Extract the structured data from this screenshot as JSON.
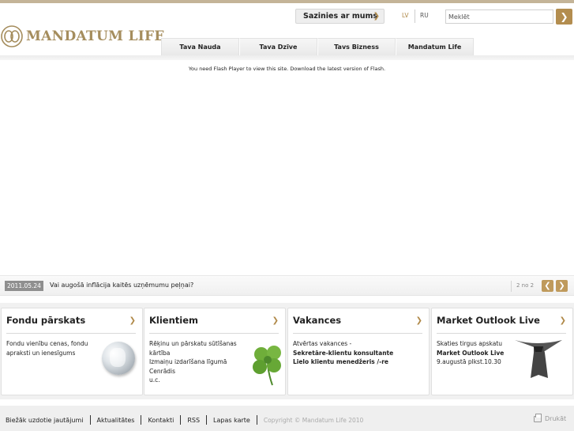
{
  "header": {
    "logo_text": "MANDATUM LIFE",
    "contact_label": "Sazinies ar mums",
    "languages": [
      "LV",
      "RU"
    ],
    "search_placeholder": "Meklēt"
  },
  "nav": {
    "tabs": [
      "Tava Nauda",
      "Tava Dzīve",
      "Tavs Bizness",
      "Mandatum Life"
    ]
  },
  "main": {
    "flash_message": "You need Flash Player to view this site. Download the latest version of Flash."
  },
  "news": {
    "date": "2011.05.24",
    "headline": "Vai augošā inflācija kaitēs uzņēmumu peļņai?",
    "pager": "2 no 2"
  },
  "boxes": [
    {
      "title": "Fondu pārskats",
      "lines": [
        "Fondu vienību cenas, fondu",
        "apraksti un ienesīgums"
      ]
    },
    {
      "title": "Klientiem",
      "lines": [
        "Rēķinu un pārskatu sūtīšanas",
        "kārtība",
        "Izmaiņu izdarīšana līgumā",
        "Cenrādis",
        "u.c."
      ]
    },
    {
      "title": "Vakances",
      "lines": [
        "Atvērtas vakances -",
        "Sekretāre-klientu konsultante",
        "Lielo klientu menedžeris /-re"
      ]
    },
    {
      "title": "Market Outlook Live",
      "lines": [
        "Skaties tirgus apskatu",
        "Market Outlook Live",
        "9.augustā plkst.10.30"
      ]
    }
  ],
  "footer": {
    "links": [
      "Biežāk uzdotie jautājumi",
      "Aktualitātes",
      "Kontakti",
      "RSS",
      "Lapas karte"
    ],
    "copyright": "Copyright © Mandatum Life 2010",
    "print_label": "Drukāt"
  },
  "colors": {
    "accent": "#b38d4f",
    "logo": "#a58d5d",
    "topline": "#c4b498"
  }
}
